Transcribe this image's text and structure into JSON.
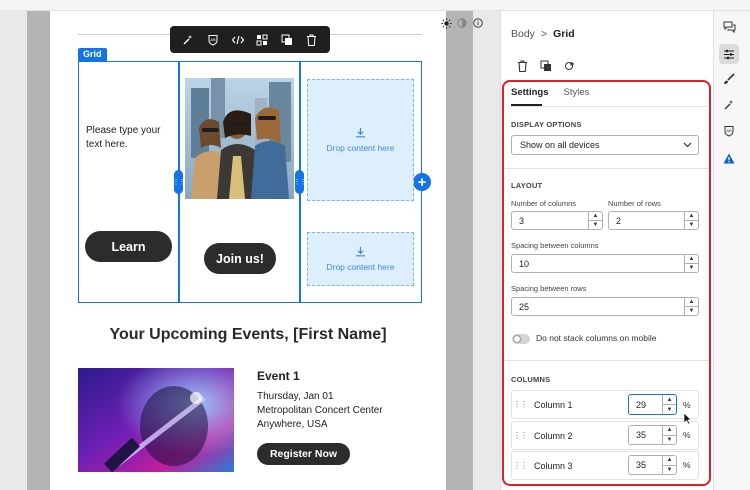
{
  "canvas": {
    "grid_tag": "Grid",
    "col1_text": "Please type your text here.",
    "learn_button": "Learn",
    "join_button": "Join us!",
    "drop_text_1": "Drop content here",
    "drop_text_2": "Drop content here",
    "events_title": "Your Upcoming Events, [First Name]",
    "event": {
      "name": "Event 1",
      "date": "Thursday, Jan 01",
      "venue": "Metropolitan Concert Center",
      "city": "Anywhere, USA",
      "register_button": "Register Now"
    },
    "toolbar_icons": [
      "magic-icon",
      "accessibility-icon",
      "code-icon",
      "layout-icon",
      "duplicate-icon",
      "trash-icon"
    ]
  },
  "panel": {
    "breadcrumb": {
      "parent": "Body",
      "separator": ">",
      "current": "Grid"
    },
    "tabs": [
      "Settings",
      "Styles"
    ],
    "display_options": {
      "heading": "DISPLAY OPTIONS",
      "value": "Show on all devices"
    },
    "layout": {
      "heading": "LAYOUT",
      "columns_label": "Number of columns",
      "columns_value": "3",
      "rows_label": "Number of rows",
      "rows_value": "2",
      "col_spacing_label": "Spacing between columns",
      "col_spacing_value": "10",
      "row_spacing_label": "Spacing between rows",
      "row_spacing_value": "25",
      "stack_toggle_label": "Do not stack columns on mobile"
    },
    "columns": {
      "heading": "COLUMNS",
      "items": [
        {
          "name": "Column 1",
          "value": "29",
          "unit": "%"
        },
        {
          "name": "Column 2",
          "value": "35",
          "unit": "%"
        },
        {
          "name": "Column 3",
          "value": "35",
          "unit": "%"
        }
      ]
    }
  },
  "colors": {
    "accent_blue": "#1473e6",
    "highlight_red": "#d7232d",
    "button_dark": "#2c2c2c"
  }
}
